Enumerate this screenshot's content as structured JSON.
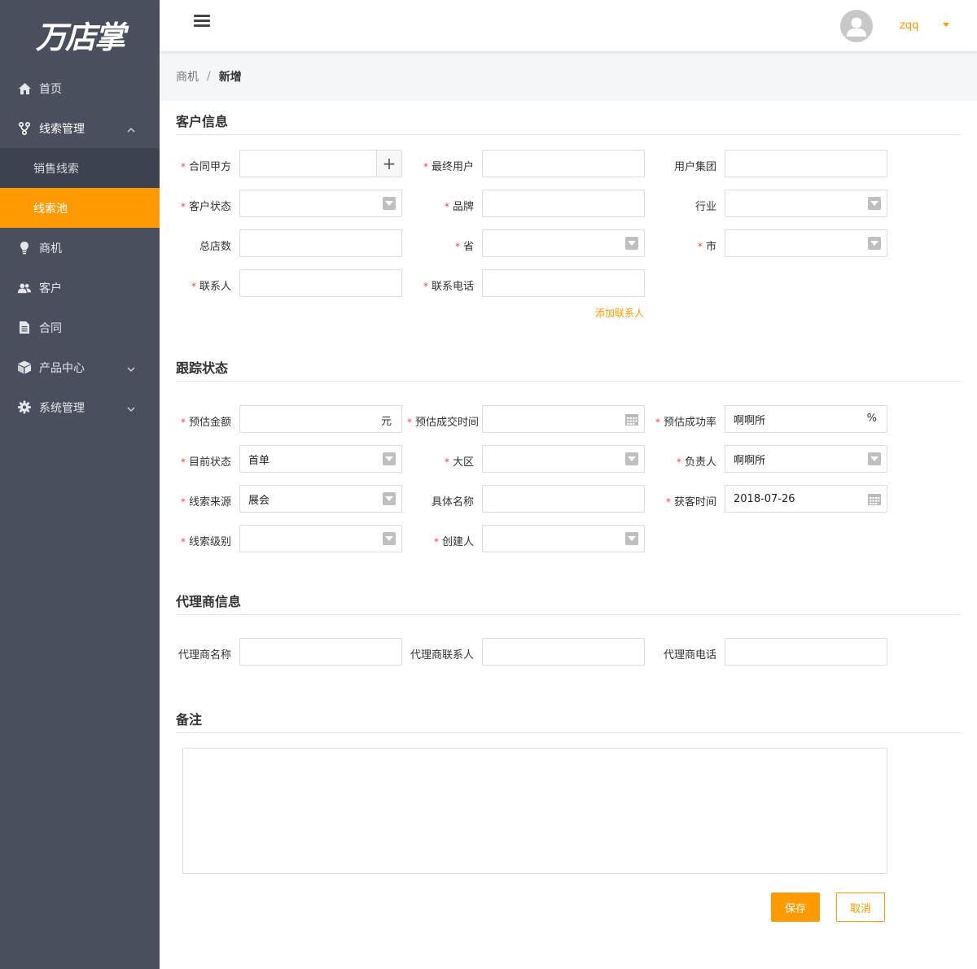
{
  "logo": {
    "text": "万店掌"
  },
  "sidebar": {
    "items": [
      {
        "label": "首页",
        "icon": "home-icon"
      },
      {
        "label": "线索管理",
        "icon": "branch-icon",
        "expanded": true,
        "children": [
          {
            "label": "销售线索"
          },
          {
            "label": "线索池",
            "active": true
          }
        ]
      },
      {
        "label": "商机",
        "icon": "lightbulb-icon"
      },
      {
        "label": "客户",
        "icon": "users-icon"
      },
      {
        "label": "合同",
        "icon": "document-icon"
      },
      {
        "label": "产品中心",
        "icon": "cube-icon",
        "expandable": true
      },
      {
        "label": "系统管理",
        "icon": "gear-icon",
        "expandable": true
      }
    ]
  },
  "header": {
    "username": "zqq"
  },
  "breadcrumb": {
    "parent": "商机",
    "separator": "/",
    "current": "新增"
  },
  "sections": {
    "customer": {
      "title": "客户信息",
      "fields": {
        "party_a": {
          "label": "合同甲方",
          "required": true,
          "value": ""
        },
        "end_user": {
          "label": "最终用户",
          "required": true,
          "value": ""
        },
        "user_group": {
          "label": "用户集团",
          "required": false,
          "value": ""
        },
        "customer_status": {
          "label": "客户状态",
          "required": true,
          "value": ""
        },
        "brand": {
          "label": "品牌",
          "required": true,
          "value": ""
        },
        "industry": {
          "label": "行业",
          "required": false,
          "value": ""
        },
        "store_count": {
          "label": "总店数",
          "required": false,
          "value": ""
        },
        "province": {
          "label": "省",
          "required": true,
          "value": ""
        },
        "city": {
          "label": "市",
          "required": true,
          "value": ""
        },
        "contact": {
          "label": "联系人",
          "required": true,
          "value": ""
        },
        "phone": {
          "label": "联系电话",
          "required": true,
          "value": ""
        }
      },
      "add_contact": "添加联系人"
    },
    "tracking": {
      "title": "跟踪状态",
      "fields": {
        "est_amount": {
          "label": "预估金额",
          "required": true,
          "value": "",
          "suffix": "元"
        },
        "est_close_time": {
          "label": "预估成交时间",
          "required": true,
          "value": ""
        },
        "est_rate": {
          "label": "预估成功率",
          "required": true,
          "value": "啊啊所",
          "suffix": "%"
        },
        "current_status": {
          "label": "目前状态",
          "required": true,
          "value": "首单"
        },
        "region": {
          "label": "大区",
          "required": true,
          "value": ""
        },
        "owner": {
          "label": "负责人",
          "required": true,
          "value": "啊啊所"
        },
        "lead_source": {
          "label": "线索来源",
          "required": true,
          "value": "展会"
        },
        "specific_name": {
          "label": "具体名称",
          "required": false,
          "value": ""
        },
        "acquire_time": {
          "label": "获客时间",
          "required": true,
          "value": "2018-07-26"
        },
        "lead_level": {
          "label": "线索级别",
          "required": true,
          "value": ""
        },
        "creator": {
          "label": "创建人",
          "required": true,
          "value": ""
        }
      }
    },
    "agent": {
      "title": "代理商信息",
      "fields": {
        "agent_name": {
          "label": "代理商名称",
          "value": ""
        },
        "agent_contact": {
          "label": "代理商联系人",
          "value": ""
        },
        "agent_phone": {
          "label": "代理商电话",
          "value": ""
        }
      }
    },
    "remark": {
      "title": "备注",
      "value": ""
    }
  },
  "actions": {
    "save": "保存",
    "cancel": "取消"
  },
  "colors": {
    "accent": "#ff9a00",
    "sidebar_bg": "#4a4f5e",
    "required": "#ff4444"
  }
}
